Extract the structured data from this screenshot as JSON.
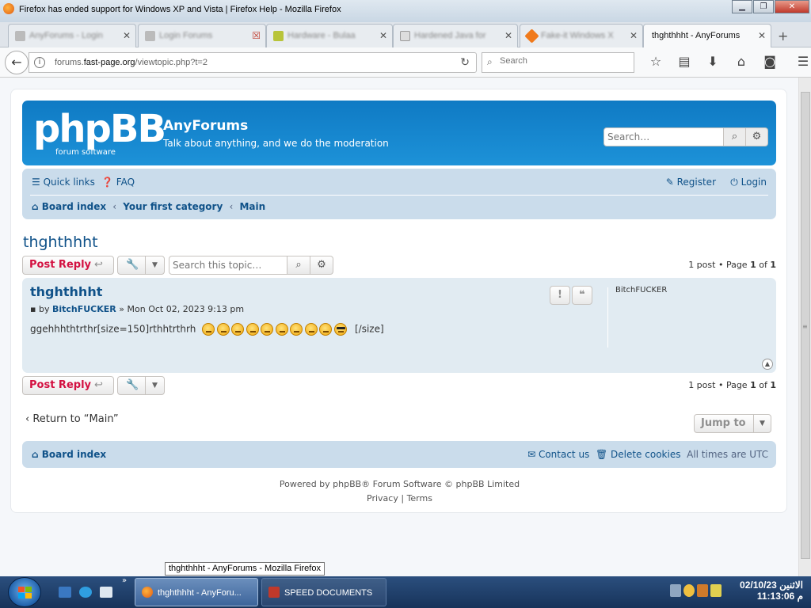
{
  "window": {
    "title": "Firefox has ended support for Windows XP and Vista | Firefox Help - Mozilla Firefox",
    "minimize": "▁",
    "maximize": "❐",
    "close": "✕"
  },
  "tabs": [
    {
      "label": "AnyForums - Login",
      "active": false,
      "blurred": true
    },
    {
      "label": "Login Forums",
      "active": false,
      "blurred": true
    },
    {
      "label": "Hardware - Bulaa",
      "active": false,
      "blurred": true
    },
    {
      "label": "Hardened Java for",
      "active": false,
      "blurred": true
    },
    {
      "label": "Fake-it Windows X",
      "active": false,
      "blurred": true
    },
    {
      "label": "thghthhht - AnyForums",
      "active": true,
      "blurred": false
    }
  ],
  "navbar": {
    "url_prefix": "forums.",
    "url_domain": "fast-page.org",
    "url_path": "/viewtopic.php?t=2",
    "search_placeholder": "Search"
  },
  "header": {
    "logo_text": "phpBB",
    "logo_sub": "forum software",
    "site_name": "AnyForums",
    "site_desc": "Talk about anything, and we do the moderation",
    "search_placeholder": "Search…"
  },
  "nav": {
    "quick_links": "Quick links",
    "faq": "FAQ",
    "register": "Register",
    "login": "Login",
    "breadcrumbs": [
      "Board index",
      "Your first category",
      "Main"
    ]
  },
  "topic": {
    "title": "thghthhht",
    "post_reply": "Post Reply",
    "search_placeholder": "Search this topic…",
    "pagination": {
      "count_text": "1 post",
      "page_label": "Page",
      "current": "1",
      "of": "of",
      "total": "1"
    }
  },
  "post": {
    "title": "thghthhht",
    "by": "by",
    "author": "BitchFUCKER",
    "date": "Mon Oct 02, 2023 9:13 pm",
    "content_before": "ggehhhthtrthr[size=150]rthhtrthrh",
    "content_after": "[/size]",
    "smiley_count": 10,
    "profile_name": "BitchFUCKER"
  },
  "bottom": {
    "return_link": "Return to “Main”",
    "jump_to": "Jump to",
    "footer_board_index": "Board index",
    "contact_us": "Contact us",
    "delete_cookies": "Delete cookies",
    "timezone": "All times are UTC",
    "powered_by": "Powered by phpBB® Forum Software © phpBB Limited",
    "privacy": "Privacy",
    "terms": "Terms",
    "link_sep": "|"
  },
  "tooltip": "thghthhht - AnyForums - Mozilla Firefox",
  "taskbar": {
    "firefox_task": "thghthhht - AnyForu...",
    "speed_task": "SPEED DOCUMENTS",
    "clock_date": "الاثنين 02/10/23",
    "clock_time": "11:13:06 م"
  },
  "colors": {
    "header_blue": "#1d92d8",
    "nav_block": "#cadceb",
    "post_bg": "#e1ebf2",
    "link": "#105289",
    "reply_red": "#d31141"
  }
}
